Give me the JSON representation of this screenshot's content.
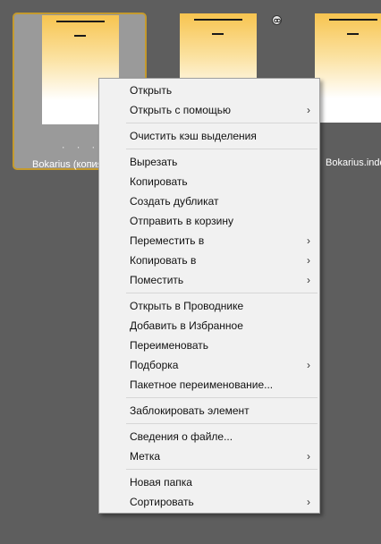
{
  "files": [
    {
      "caption": "Bokarius (копия)",
      "dots": "· · · ·",
      "selected": true
    },
    {
      "caption": "",
      "dots": "",
      "selected": false
    },
    {
      "caption": "Bokarius.indd",
      "dots": "",
      "selected": false
    }
  ],
  "colors": {
    "background": "#5e5e5e",
    "selection_border": "#c49a2e",
    "thumbnail_accent": "#f7c44f",
    "menu_background": "#f1f1f1"
  },
  "icons": {
    "link_badge": "link-icon",
    "submenu": "chevron-right-icon"
  },
  "context_menu": {
    "groups": [
      [
        {
          "label": "Открыть",
          "submenu": false
        },
        {
          "label": "Открыть с помощью",
          "submenu": true
        }
      ],
      [
        {
          "label": "Очистить кэш выделения",
          "submenu": false
        }
      ],
      [
        {
          "label": "Вырезать",
          "submenu": false
        },
        {
          "label": "Копировать",
          "submenu": false
        },
        {
          "label": "Создать дубликат",
          "submenu": false
        },
        {
          "label": "Отправить в корзину",
          "submenu": false
        },
        {
          "label": "Переместить в",
          "submenu": true
        },
        {
          "label": "Копировать в",
          "submenu": true
        },
        {
          "label": "Поместить",
          "submenu": true
        }
      ],
      [
        {
          "label": "Открыть в Проводнике",
          "submenu": false
        },
        {
          "label": "Добавить в Избранное",
          "submenu": false
        },
        {
          "label": "Переименовать",
          "submenu": false
        },
        {
          "label": "Подборка",
          "submenu": true
        },
        {
          "label": "Пакетное переименование...",
          "submenu": false
        }
      ],
      [
        {
          "label": "Заблокировать элемент",
          "submenu": false
        }
      ],
      [
        {
          "label": "Сведения о файле...",
          "submenu": false
        },
        {
          "label": "Метка",
          "submenu": true
        }
      ],
      [
        {
          "label": "Новая папка",
          "submenu": false
        },
        {
          "label": "Сортировать",
          "submenu": true
        }
      ]
    ]
  }
}
